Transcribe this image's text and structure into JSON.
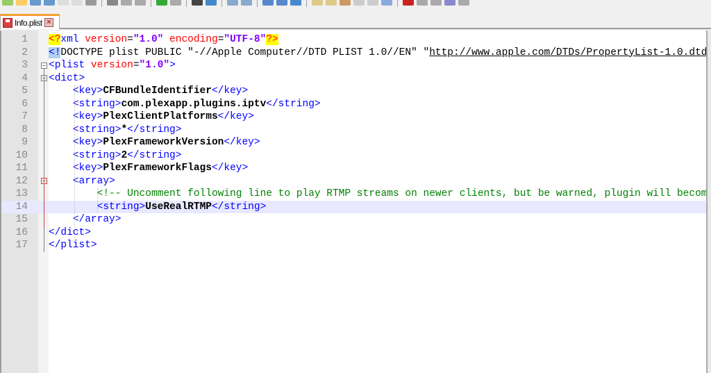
{
  "toolbar": {
    "icons": [
      "new-icon",
      "open-icon",
      "save-icon",
      "save-all-icon",
      "close-icon",
      "close-all-icon",
      "print-icon",
      "cut-icon",
      "copy-icon",
      "paste-icon",
      "undo-icon",
      "redo-icon",
      "find-icon",
      "replace-icon",
      "zoom-in-icon",
      "zoom-out-icon",
      "sync-v-icon",
      "sync-h-icon",
      "wrap-icon",
      "all-chars-icon",
      "indent-guide-icon",
      "lang-icon",
      "doc-map-icon",
      "function-list-icon",
      "monitor-icon",
      "record-icon",
      "stop-icon",
      "play-icon",
      "play-multi-icon",
      "save-macro-icon"
    ]
  },
  "tab": {
    "label": "Info.plist"
  },
  "colors": {
    "tag": "#0000ff",
    "attr": "#ff0000",
    "value": "#8000ff",
    "comment": "#008000",
    "current_line": "#e8e8ff",
    "fold_active": "#d04040"
  },
  "current_line": 14,
  "lines": [
    {
      "n": "1",
      "tokens": [
        {
          "t": "pi",
          "s": "<?"
        },
        {
          "t": "tag",
          "s": "xml "
        },
        {
          "t": "attr",
          "s": "version"
        },
        {
          "t": "plain",
          "s": "="
        },
        {
          "t": "val",
          "s": "\"1.0\""
        },
        {
          "t": "attr",
          "s": " encoding"
        },
        {
          "t": "plain",
          "s": "="
        },
        {
          "t": "val",
          "s": "\"UTF-8\""
        },
        {
          "t": "pi",
          "s": "?>"
        }
      ]
    },
    {
      "n": "2",
      "tokens": [
        {
          "t": "docmark",
          "s": "<!"
        },
        {
          "t": "doc",
          "s": "DOCTYPE plist PUBLIC \"-//Apple Computer//DTD PLIST 1.0//EN\" \""
        },
        {
          "t": "url",
          "s": "http://www.apple.com/DTDs/PropertyList-1.0.dtd"
        },
        {
          "t": "doc",
          "s": "\">"
        }
      ]
    },
    {
      "n": "3",
      "tokens": [
        {
          "t": "tag",
          "s": "<plist "
        },
        {
          "t": "attr",
          "s": "version"
        },
        {
          "t": "plain",
          "s": "="
        },
        {
          "t": "val",
          "s": "\"1.0\""
        },
        {
          "t": "tag",
          "s": ">"
        }
      ]
    },
    {
      "n": "4",
      "tokens": [
        {
          "t": "tag",
          "s": "<dict>"
        }
      ]
    },
    {
      "n": "5",
      "tokens": [
        {
          "t": "plain",
          "s": "    "
        },
        {
          "t": "tag",
          "s": "<key>"
        },
        {
          "t": "text",
          "s": "CFBundleIdentifier"
        },
        {
          "t": "tag",
          "s": "</key>"
        }
      ]
    },
    {
      "n": "6",
      "tokens": [
        {
          "t": "plain",
          "s": "    "
        },
        {
          "t": "tag",
          "s": "<string>"
        },
        {
          "t": "text",
          "s": "com.plexapp.plugins.iptv"
        },
        {
          "t": "tag",
          "s": "</string>"
        }
      ]
    },
    {
      "n": "7",
      "tokens": [
        {
          "t": "plain",
          "s": "    "
        },
        {
          "t": "tag",
          "s": "<key>"
        },
        {
          "t": "text",
          "s": "PlexClientPlatforms"
        },
        {
          "t": "tag",
          "s": "</key>"
        }
      ]
    },
    {
      "n": "8",
      "tokens": [
        {
          "t": "plain",
          "s": "    "
        },
        {
          "t": "tag",
          "s": "<string>"
        },
        {
          "t": "text",
          "s": "*"
        },
        {
          "t": "tag",
          "s": "</string>"
        }
      ]
    },
    {
      "n": "9",
      "tokens": [
        {
          "t": "plain",
          "s": "    "
        },
        {
          "t": "tag",
          "s": "<key>"
        },
        {
          "t": "text",
          "s": "PlexFrameworkVersion"
        },
        {
          "t": "tag",
          "s": "</key>"
        }
      ]
    },
    {
      "n": "10",
      "tokens": [
        {
          "t": "plain",
          "s": "    "
        },
        {
          "t": "tag",
          "s": "<string>"
        },
        {
          "t": "text",
          "s": "2"
        },
        {
          "t": "tag",
          "s": "</string>"
        }
      ]
    },
    {
      "n": "11",
      "tokens": [
        {
          "t": "plain",
          "s": "    "
        },
        {
          "t": "tag",
          "s": "<key>"
        },
        {
          "t": "text",
          "s": "PlexFrameworkFlags"
        },
        {
          "t": "tag",
          "s": "</key>"
        }
      ]
    },
    {
      "n": "12",
      "tokens": [
        {
          "t": "plain",
          "s": "    "
        },
        {
          "t": "tag",
          "s": "<array>"
        }
      ]
    },
    {
      "n": "13",
      "tokens": [
        {
          "t": "plain",
          "s": "        "
        },
        {
          "t": "comment",
          "s": "<!-- Uncomment following line to play RTMP streams on newer clients, but be warned, plugin will become"
        }
      ]
    },
    {
      "n": "14",
      "tokens": [
        {
          "t": "plain",
          "s": "        "
        },
        {
          "t": "tag",
          "s": "<string>"
        },
        {
          "t": "text",
          "s": "UseRealRTMP"
        },
        {
          "t": "tag",
          "s": "</string>"
        }
      ]
    },
    {
      "n": "15",
      "tokens": [
        {
          "t": "plain",
          "s": "    "
        },
        {
          "t": "tag",
          "s": "</array>"
        }
      ]
    },
    {
      "n": "16",
      "tokens": [
        {
          "t": "tag",
          "s": "</dict>"
        }
      ]
    },
    {
      "n": "17",
      "tokens": [
        {
          "t": "tag",
          "s": "</plist>"
        }
      ]
    }
  ]
}
